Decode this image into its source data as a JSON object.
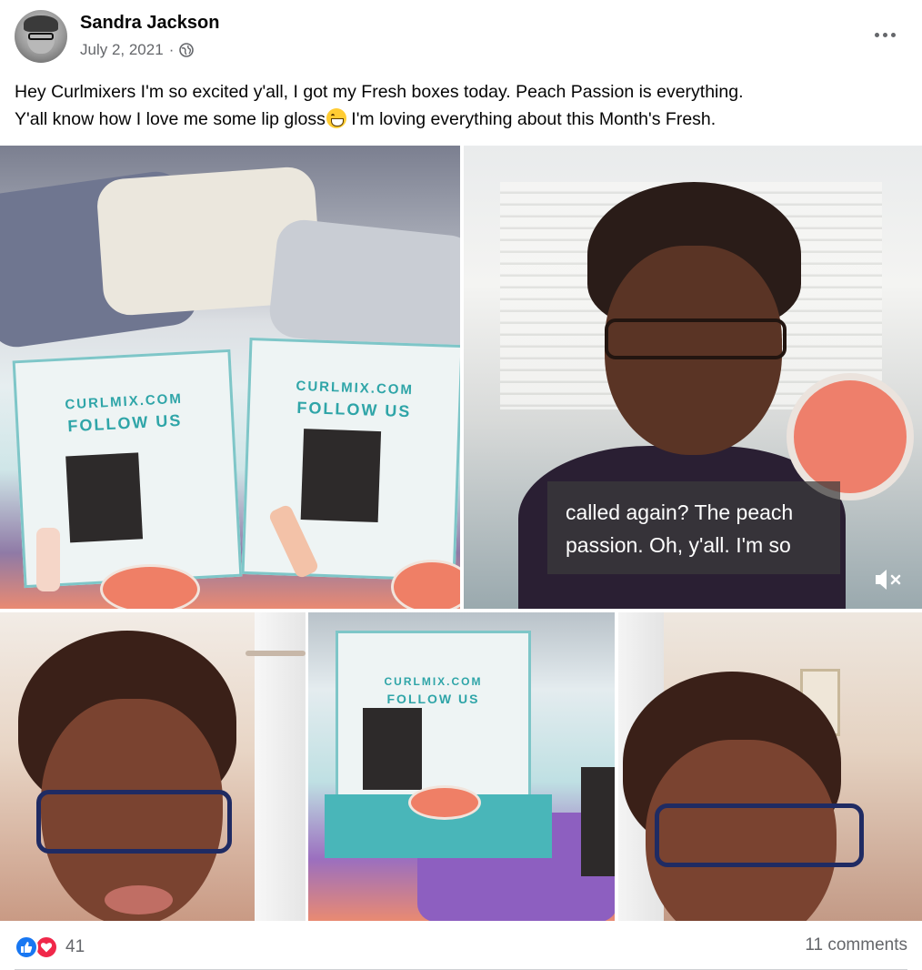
{
  "post": {
    "author": "Sandra Jackson",
    "date": "July 2, 2021",
    "separator": "·",
    "audience_icon": "globe-icon",
    "text_line1": "Hey Curlmixers I'm so excited y'all, I got my Fresh boxes today. Peach Passion is everything.",
    "text_line2_before": "Y'all know how I love me some lip gloss",
    "text_line2_emoji": "grinning-face-emoji",
    "text_line2_after": " I'm loving everything about this Month's Fresh."
  },
  "photos": {
    "box_label_top": "CURLMIX.COM",
    "box_label_bottom": "FOLLOW US",
    "video_caption_line1": "called again? The peach",
    "video_caption_line2": "passion. Oh, y'all. I'm so",
    "mute_icon": "muted-speaker-icon"
  },
  "footer": {
    "reaction_icons": [
      "like-icon",
      "love-icon"
    ],
    "reaction_count": "41",
    "comments": "11 comments"
  },
  "colors": {
    "like": "#1877f2",
    "love": "#f0284a",
    "secondary_text": "#65676b",
    "box_accent": "#2fa5a8"
  }
}
